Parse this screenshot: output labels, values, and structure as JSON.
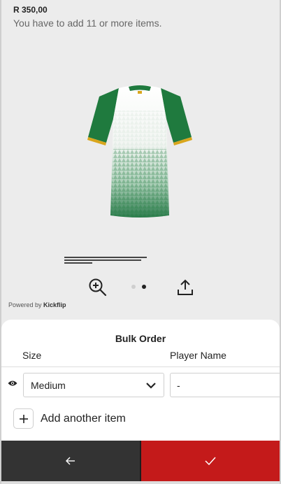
{
  "product": {
    "price": "R 350,00",
    "min_items_note": "You have to add 11 or more items.",
    "image_icon": "jersey-back-image",
    "colors": {
      "green": "#1f7a3e",
      "gold": "#d9a61c"
    }
  },
  "viewer": {
    "zoom_icon": "zoom-in-icon",
    "share_icon": "share-icon",
    "page_count": 2,
    "active_page": 2
  },
  "branding": {
    "powered_prefix": "Powered by ",
    "brand": "Kickflip"
  },
  "bulk_order": {
    "title": "Bulk Order",
    "columns": {
      "size": "Size",
      "player_name": "Player Name"
    },
    "rows": [
      {
        "visibility_icon": "eye-icon",
        "size": "Medium",
        "player_name": "-"
      }
    ],
    "add_item_label": "Add another item"
  },
  "footer": {
    "back_icon": "arrow-left-icon",
    "confirm_icon": "checkmark-icon",
    "back_color": "#333333",
    "confirm_color": "#c41a1a"
  }
}
